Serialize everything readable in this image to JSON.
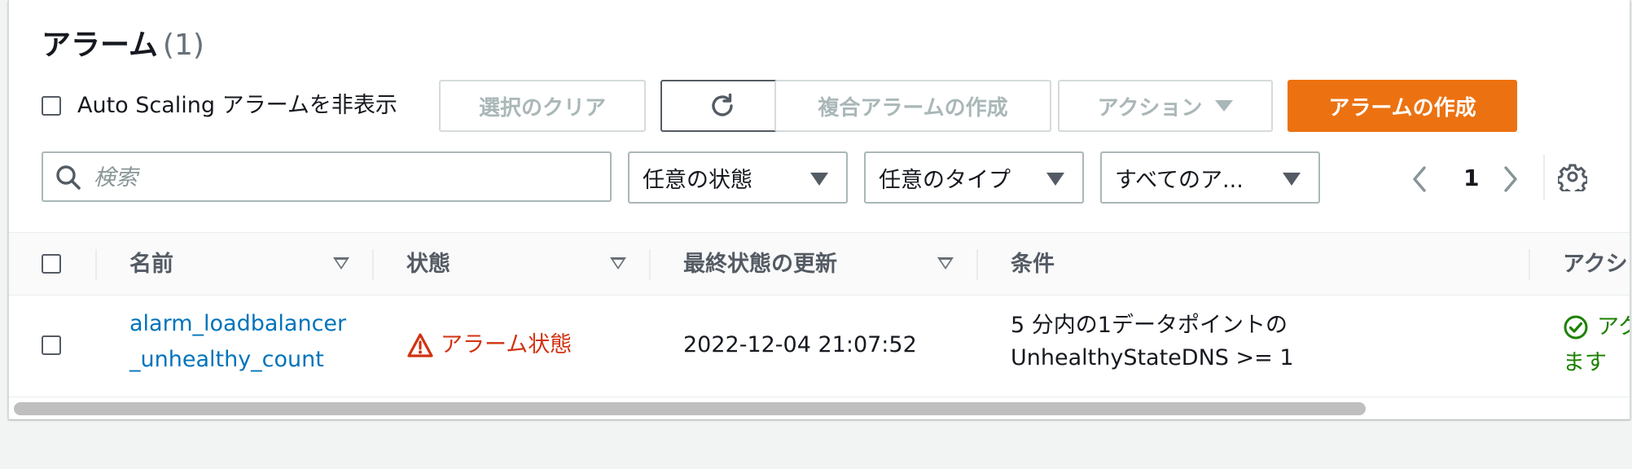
{
  "header": {
    "title": "アラーム",
    "count": "(1)"
  },
  "toolbar": {
    "hide_autoscaling_label": "Auto Scaling アラームを非表示",
    "clear_selection_label": "選択のクリア",
    "create_composite_label": "複合アラームの作成",
    "actions_label": "アクション",
    "create_alarm_label": "アラームの作成"
  },
  "filters": {
    "search_placeholder": "検索",
    "state_select": "任意の状態",
    "type_select": "任意のタイプ",
    "actions_select": "すべてのア..."
  },
  "pagination": {
    "current_page": "1"
  },
  "table": {
    "columns": [
      "名前",
      "状態",
      "最終状態の更新",
      "条件",
      "アクシ"
    ],
    "rows": [
      {
        "name_line1": "alarm_loadbalancer",
        "name_line2": "_unhealthy_count",
        "state": "アラーム状態",
        "last_update": "2022-12-04 21:07:52",
        "condition_line1": "5 分内の1データポイントの",
        "condition_line2": "UnhealthyStateDNS >= 1",
        "actions_line1": "アク",
        "actions_line2": "ます"
      }
    ]
  },
  "colors": {
    "primary": "#ec7211",
    "link": "#0073bb",
    "alarm": "#d13212",
    "ok": "#1d8102"
  }
}
